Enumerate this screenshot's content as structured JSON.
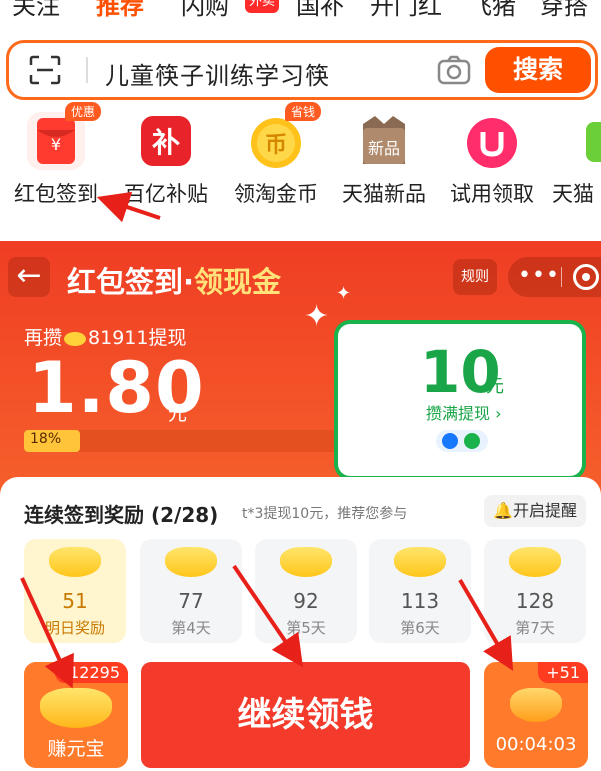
{
  "top_tabs": [
    {
      "label": "关注"
    },
    {
      "label": "推荐"
    },
    {
      "label": "闪购"
    },
    {
      "label": "国补"
    },
    {
      "label": "开门红"
    },
    {
      "label": "飞猪"
    },
    {
      "label": "穿搭"
    }
  ],
  "top_tab_badge": "外卖",
  "search": {
    "query": "儿童筷子训练学习筷",
    "button_label": "搜索"
  },
  "shortcuts": [
    {
      "label": "红包签到",
      "badge": "优惠",
      "icon": "red-envelope-icon"
    },
    {
      "label": "百亿补贴",
      "badge": "",
      "icon": "subsidy-icon"
    },
    {
      "label": "领淘金币",
      "badge": "省钱",
      "icon": "gold-coin-icon"
    },
    {
      "label": "天猫新品",
      "badge": "",
      "icon": "new-product-icon"
    },
    {
      "label": "试用领取",
      "badge": "",
      "icon": "trial-icon"
    },
    {
      "label": "天猫",
      "badge": "",
      "icon": "tmall-icon"
    }
  ],
  "header": {
    "title_main": "红包签到·",
    "title_gold": "领现金",
    "rule_label": "规则",
    "capsule_dots": "•••"
  },
  "balance": {
    "save_prefix": "再攒",
    "save_suffix": "81911提现",
    "amount": "1.80",
    "unit": "元",
    "progress_label": "18%",
    "progress_fraction": 0.18
  },
  "cash_card": {
    "amount": "10",
    "unit": "元",
    "subtitle": "攒满提现 ›"
  },
  "signin": {
    "title": "连续签到奖励 (2/28)",
    "subtitle": "t*3提现10元，推荐您参与",
    "remind_label": "开启提醒",
    "days": [
      {
        "value": "51",
        "label": "明日奖励"
      },
      {
        "value": "77",
        "label": "第4天"
      },
      {
        "value": "92",
        "label": "第5天"
      },
      {
        "value": "113",
        "label": "第6天"
      },
      {
        "value": "128",
        "label": "第7天"
      }
    ]
  },
  "actions": {
    "earn_label": "赚元宝",
    "earn_badge": "-12295",
    "continue_label": "继续领钱",
    "timer_label": "00:04:03",
    "timer_badge": "+51"
  },
  "colors": {
    "brand_orange": "#ff5000",
    "hero_red": "#ef3d24",
    "cash_green": "#19b24b",
    "annotation_red": "#e8201a"
  }
}
